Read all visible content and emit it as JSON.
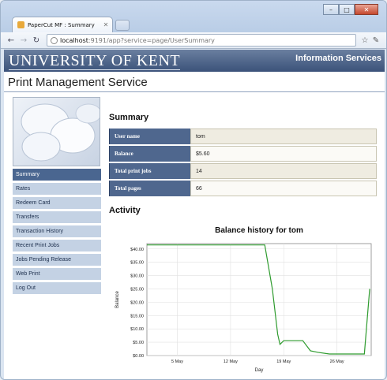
{
  "browser": {
    "tab_title": "PaperCut MF : Summary",
    "url_host": "localhost",
    "url_rest": ":9191/app?service=page/UserSummary",
    "window_buttons": [
      "minimize-icon",
      "maximize-icon",
      "close-icon"
    ]
  },
  "header": {
    "university": "UNIVERSITY OF KENT",
    "department": "Information Services",
    "service_title": "Print Management Service"
  },
  "sidebar": {
    "items": [
      {
        "label": "Summary",
        "active": true
      },
      {
        "label": "Rates",
        "active": false
      },
      {
        "label": "Redeem Card",
        "active": false
      },
      {
        "label": "Transfers",
        "active": false
      },
      {
        "label": "Transaction History",
        "active": false
      },
      {
        "label": "Recent Print Jobs",
        "active": false
      },
      {
        "label": "Jobs Pending Release",
        "active": false
      },
      {
        "label": "Web Print",
        "active": false
      },
      {
        "label": "Log Out",
        "active": false
      }
    ]
  },
  "summary": {
    "heading": "Summary",
    "rows": [
      {
        "label": "User name",
        "value": "tom"
      },
      {
        "label": "Balance",
        "value": "$5.60"
      },
      {
        "label": "Total print jobs",
        "value": "14"
      },
      {
        "label": "Total pages",
        "value": "66"
      }
    ]
  },
  "activity": {
    "heading": "Activity"
  },
  "chart_data": {
    "type": "line",
    "title": "Balance history for tom",
    "xlabel": "Day",
    "ylabel": "Balance",
    "x_ticks": [
      "5 May",
      "12 May",
      "19 May",
      "26 May"
    ],
    "y_ticks": [
      "$0.00",
      "$5.00",
      "$10.00",
      "$15.00",
      "$20.00",
      "$25.00",
      "$30.00",
      "$35.00",
      "$40.00"
    ],
    "ylim": [
      0,
      42
    ],
    "xlim": [
      1,
      30.5
    ],
    "grid": true,
    "series": [
      {
        "color": "#2e9b2e",
        "x": [
          1,
          16.5,
          17.5,
          18.2,
          18.5,
          19,
          21.5,
          22.5,
          23.5,
          25,
          29.6,
          30.3
        ],
        "y": [
          41.5,
          41.5,
          25,
          8,
          4.2,
          5.6,
          5.6,
          1.8,
          1.2,
          0.6,
          0.6,
          25
        ]
      }
    ]
  }
}
